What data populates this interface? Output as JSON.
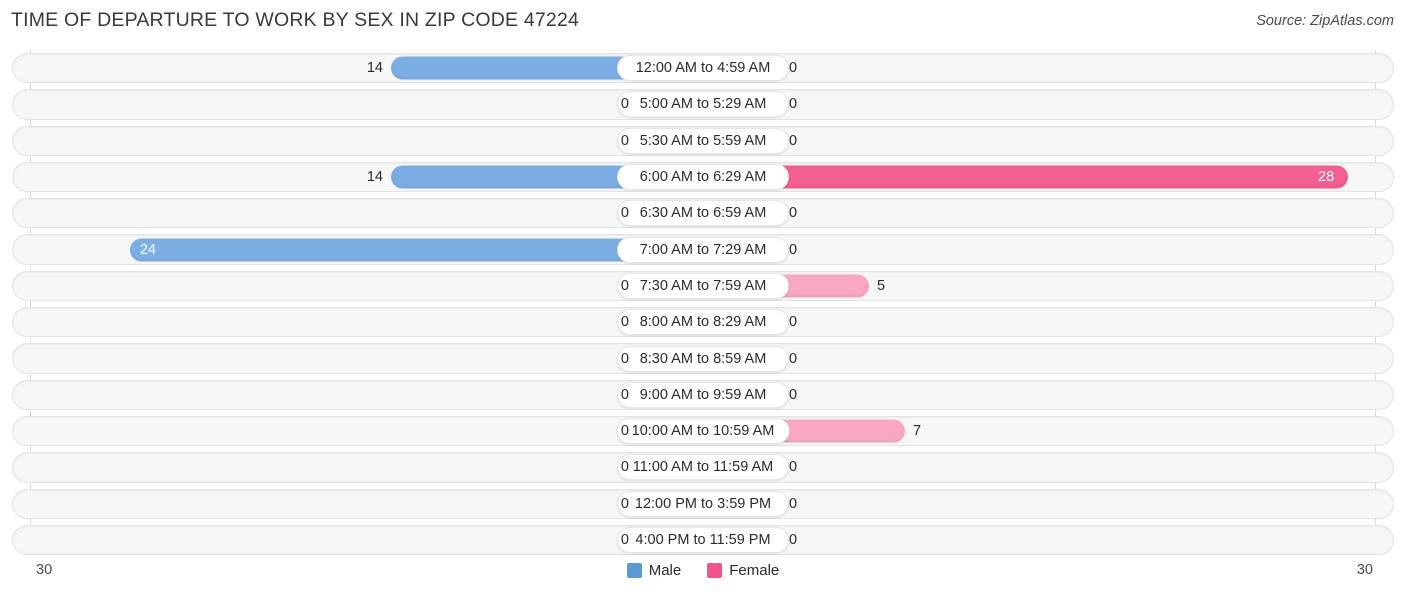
{
  "header": {
    "title": "TIME OF DEPARTURE TO WORK BY SEX IN ZIP CODE 47224",
    "source": "Source: ZipAtlas.com"
  },
  "axis": {
    "min_label": "30",
    "max_label": "30"
  },
  "legend": {
    "items": [
      {
        "label": "Male",
        "color": "#5B9BD5"
      },
      {
        "label": "Female",
        "color": "#F2558B"
      }
    ]
  },
  "colors": {
    "male_strong": "#7CAEE3",
    "male_light": "#A6C8EC",
    "female_strong": "#F45F92",
    "female_light": "#F9A8C4",
    "track": "#F7F7F7",
    "grid": "#D9D9D9"
  },
  "chart_data": {
    "type": "bar",
    "orientation": "horizontal-diverging",
    "title": "TIME OF DEPARTURE TO WORK BY SEX IN ZIP CODE 47224",
    "xlabel": "",
    "ylabel": "",
    "xlim": [
      30,
      30
    ],
    "axis_max_each_side": 30,
    "grid": false,
    "legend_position": "bottom-center",
    "categories": [
      "12:00 AM to 4:59 AM",
      "5:00 AM to 5:29 AM",
      "5:30 AM to 5:59 AM",
      "6:00 AM to 6:29 AM",
      "6:30 AM to 6:59 AM",
      "7:00 AM to 7:29 AM",
      "7:30 AM to 7:59 AM",
      "8:00 AM to 8:29 AM",
      "8:30 AM to 8:59 AM",
      "9:00 AM to 9:59 AM",
      "10:00 AM to 10:59 AM",
      "11:00 AM to 11:59 AM",
      "12:00 PM to 3:59 PM",
      "4:00 PM to 11:59 PM"
    ],
    "series": [
      {
        "name": "Male",
        "values": [
          14,
          0,
          0,
          14,
          0,
          24,
          0,
          0,
          0,
          0,
          0,
          0,
          0,
          0
        ]
      },
      {
        "name": "Female",
        "values": [
          0,
          0,
          0,
          28,
          0,
          0,
          5,
          0,
          0,
          0,
          7,
          0,
          0,
          0
        ]
      }
    ]
  },
  "rows": [
    {
      "label": "12:00 AM to 4:59 AM",
      "male": "14",
      "female": "0",
      "male_w": 312,
      "female_w": 78,
      "male_inside": false,
      "female_inside": false
    },
    {
      "label": "5:00 AM to 5:29 AM",
      "male": "0",
      "female": "0",
      "male_w": 66,
      "female_w": 78,
      "male_inside": false,
      "female_inside": false
    },
    {
      "label": "5:30 AM to 5:59 AM",
      "male": "0",
      "female": "0",
      "male_w": 66,
      "female_w": 78,
      "male_inside": false,
      "female_inside": false
    },
    {
      "label": "6:00 AM to 6:29 AM",
      "male": "14",
      "female": "28",
      "male_w": 312,
      "female_w": 645,
      "male_inside": false,
      "female_inside": true
    },
    {
      "label": "6:30 AM to 6:59 AM",
      "male": "0",
      "female": "0",
      "male_w": 66,
      "female_w": 78,
      "male_inside": false,
      "female_inside": false
    },
    {
      "label": "7:00 AM to 7:29 AM",
      "male": "24",
      "female": "0",
      "male_w": 573,
      "female_w": 78,
      "male_inside": true,
      "female_inside": false
    },
    {
      "label": "7:30 AM to 7:59 AM",
      "male": "0",
      "female": "5",
      "male_w": 66,
      "female_w": 166,
      "male_inside": false,
      "female_inside": false
    },
    {
      "label": "8:00 AM to 8:29 AM",
      "male": "0",
      "female": "0",
      "male_w": 66,
      "female_w": 78,
      "male_inside": false,
      "female_inside": false
    },
    {
      "label": "8:30 AM to 8:59 AM",
      "male": "0",
      "female": "0",
      "male_w": 66,
      "female_w": 78,
      "male_inside": false,
      "female_inside": false
    },
    {
      "label": "9:00 AM to 9:59 AM",
      "male": "0",
      "female": "0",
      "male_w": 66,
      "female_w": 78,
      "male_inside": false,
      "female_inside": false
    },
    {
      "label": "10:00 AM to 10:59 AM",
      "male": "0",
      "female": "7",
      "male_w": 66,
      "female_w": 202,
      "male_inside": false,
      "female_inside": false
    },
    {
      "label": "11:00 AM to 11:59 AM",
      "male": "0",
      "female": "0",
      "male_w": 66,
      "female_w": 78,
      "male_inside": false,
      "female_inside": false
    },
    {
      "label": "12:00 PM to 3:59 PM",
      "male": "0",
      "female": "0",
      "male_w": 66,
      "female_w": 78,
      "male_inside": false,
      "female_inside": false
    },
    {
      "label": "4:00 PM to 11:59 PM",
      "male": "0",
      "female": "0",
      "male_w": 66,
      "female_w": 78,
      "male_inside": false,
      "female_inside": false
    }
  ]
}
